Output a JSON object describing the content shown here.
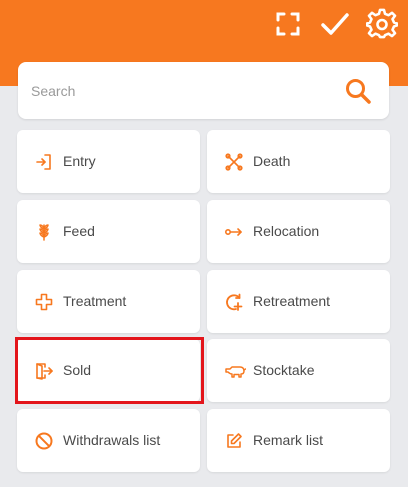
{
  "colors": {
    "accent": "#f7781f",
    "background": "#e9eaed",
    "highlight": "#e3151b"
  },
  "topbar": {
    "icons": [
      "scan-frame-icon",
      "checkmark-icon",
      "gear-icon"
    ]
  },
  "search": {
    "placeholder": "Search",
    "value": "",
    "icon": "search-icon"
  },
  "tiles": [
    {
      "label": "Entry",
      "icon": "entry-icon"
    },
    {
      "label": "Death",
      "icon": "death-icon"
    },
    {
      "label": "Feed",
      "icon": "grain-icon"
    },
    {
      "label": "Relocation",
      "icon": "relocation-icon"
    },
    {
      "label": "Treatment",
      "icon": "cross-icon"
    },
    {
      "label": "Retreatment",
      "icon": "retreatment-icon"
    },
    {
      "label": "Sold",
      "icon": "sold-icon"
    },
    {
      "label": "Stocktake",
      "icon": "pig-icon"
    },
    {
      "label": "Withdrawals list",
      "icon": "prohibited-icon"
    },
    {
      "label": "Remark list",
      "icon": "edit-icon"
    }
  ]
}
